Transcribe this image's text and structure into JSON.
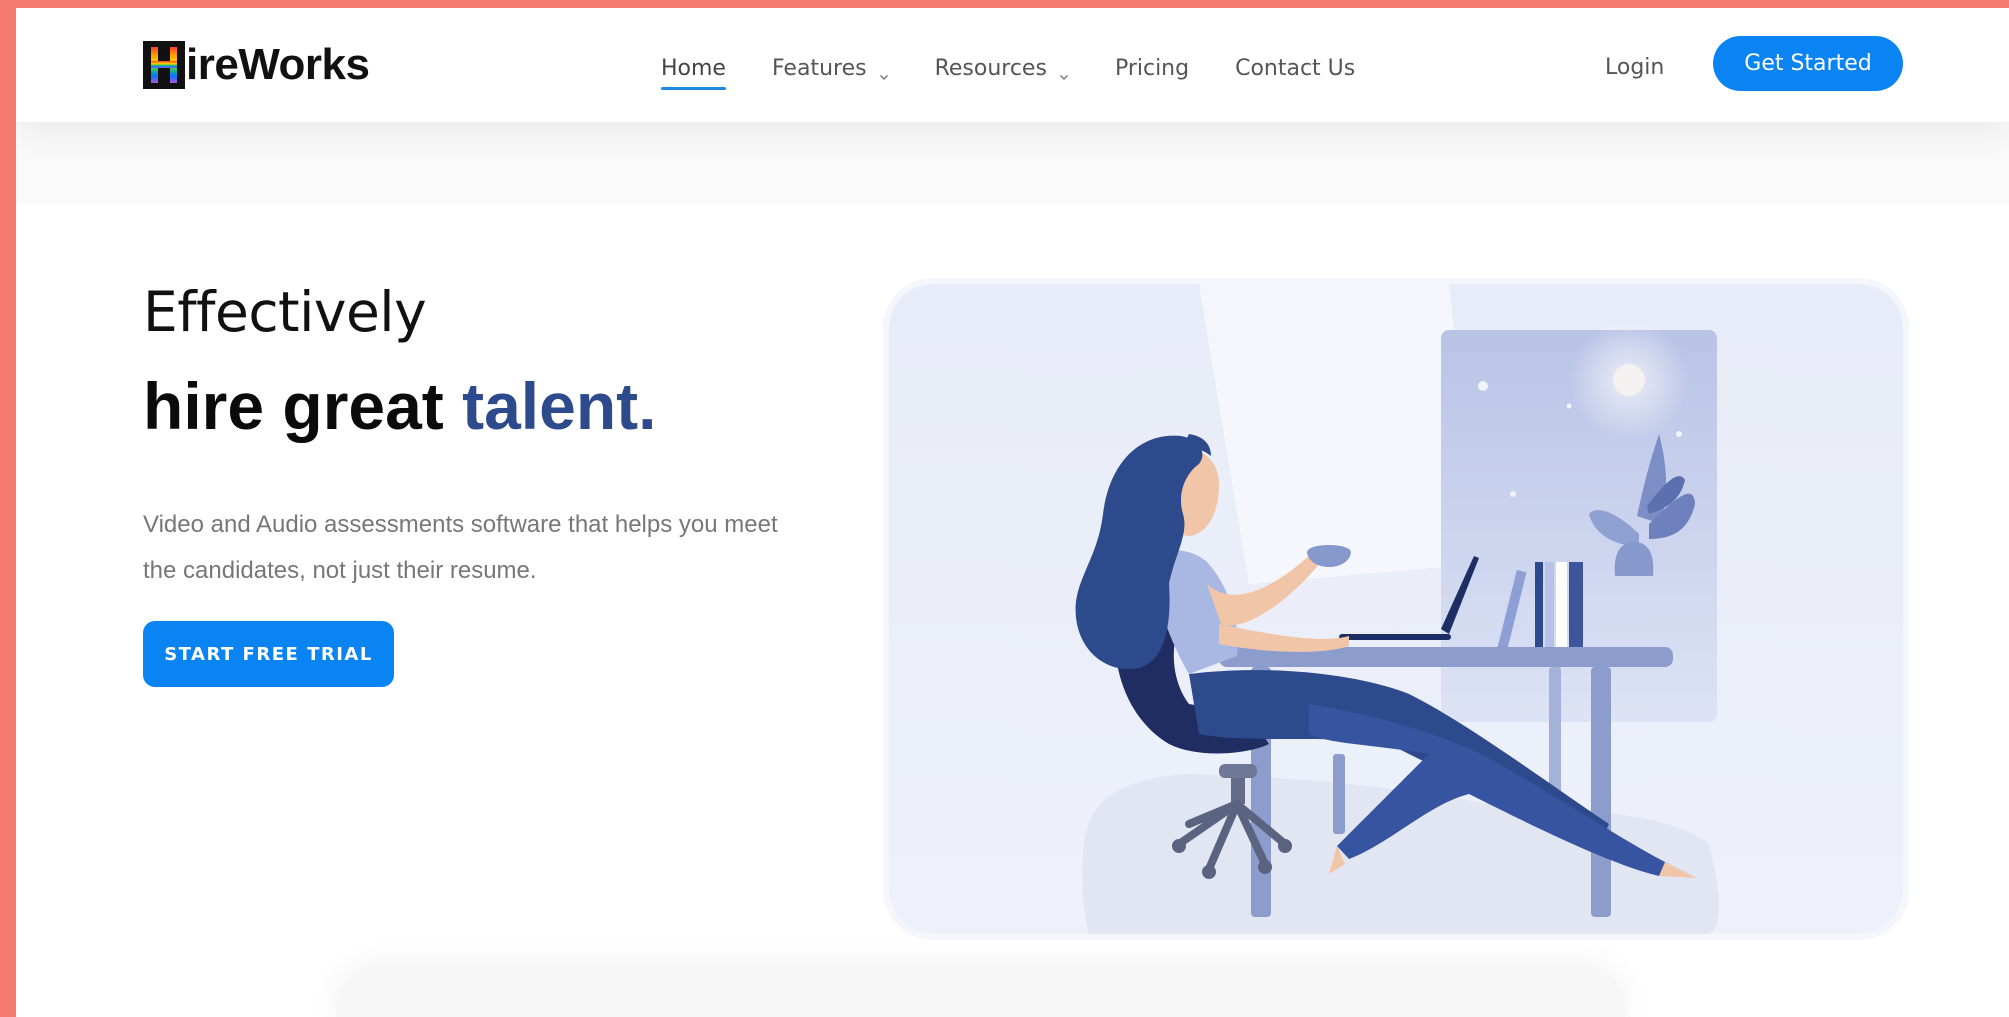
{
  "brand": {
    "logo_letter": "H",
    "logo_rest": "ireWorks"
  },
  "nav": {
    "items": [
      {
        "label": "Home",
        "active": true,
        "dropdown": false
      },
      {
        "label": "Features",
        "active": false,
        "dropdown": true
      },
      {
        "label": "Resources",
        "active": false,
        "dropdown": true
      },
      {
        "label": "Pricing",
        "active": false,
        "dropdown": false
      },
      {
        "label": "Contact Us",
        "active": false,
        "dropdown": false
      }
    ],
    "login_label": "Login",
    "get_started_label": "Get Started"
  },
  "hero": {
    "line1": "Effectively",
    "line2_main": "hire great ",
    "line2_accent": "talent.",
    "description": "Video and Audio assessments software that helps you meet the candidates, not just their resume.",
    "cta_label": "START FREE TRIAL"
  },
  "colors": {
    "frame": "#f47a70",
    "accent": "#0a84f2",
    "headline_accent": "#2d4a8c",
    "nav_active_underline": "#1e88e5"
  },
  "icons": {
    "dropdown": "chevron-down-icon"
  }
}
